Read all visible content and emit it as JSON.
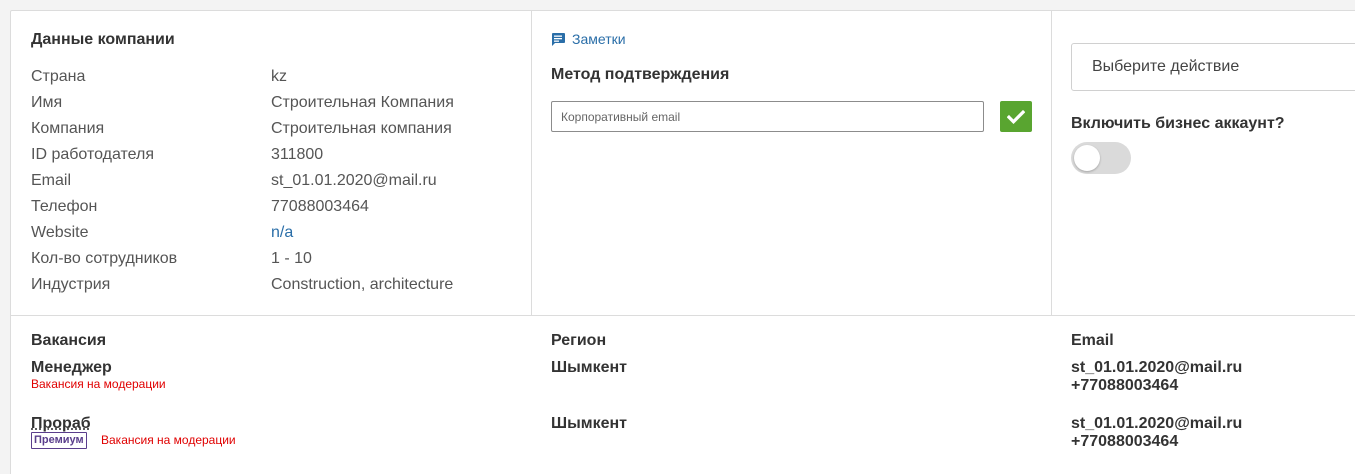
{
  "company": {
    "title": "Данные компании",
    "rows": [
      {
        "label": "Страна",
        "value": "kz"
      },
      {
        "label": "Имя",
        "value": "Строительная Компания"
      },
      {
        "label": "Компания",
        "value": "Строительная компания"
      },
      {
        "label": "ID работодателя",
        "value": "311800"
      },
      {
        "label": "Email",
        "value": "st_01.01.2020@mail.ru"
      },
      {
        "label": "Телефон",
        "value": "77088003464"
      },
      {
        "label": "Website",
        "value": "n/a"
      },
      {
        "label": "Кол-во сотрудников",
        "value": "1 - 10"
      },
      {
        "label": "Индустрия",
        "value": "Construction, architecture"
      }
    ]
  },
  "verification": {
    "notes_label": "Заметки",
    "title": "Метод подтверждения",
    "input_placeholder": "Корпоративный email"
  },
  "actions": {
    "select_label": "Выберите действие",
    "business_label": "Включить бизнес аккаунт?",
    "business_enabled": false
  },
  "vacancies": {
    "headers": {
      "vacancy": "Вакансия",
      "region": "Регион",
      "email": "Email"
    },
    "rows": [
      {
        "title": "Менеджер",
        "badge": "",
        "status": "Вакансия на модерации",
        "region": "Шымкент",
        "email": "st_01.01.2020@mail.ru",
        "phone": "+77088003464"
      },
      {
        "title": "Прораб",
        "badge": "Премиум",
        "status": "Вакансия на модерации",
        "region": "Шымкент",
        "email": "st_01.01.2020@mail.ru",
        "phone": "+77088003464"
      }
    ]
  },
  "colors": {
    "accent": "#2a6ea8",
    "confirm": "#59a530",
    "status": "#e00000",
    "premium": "#5a3e8c"
  }
}
